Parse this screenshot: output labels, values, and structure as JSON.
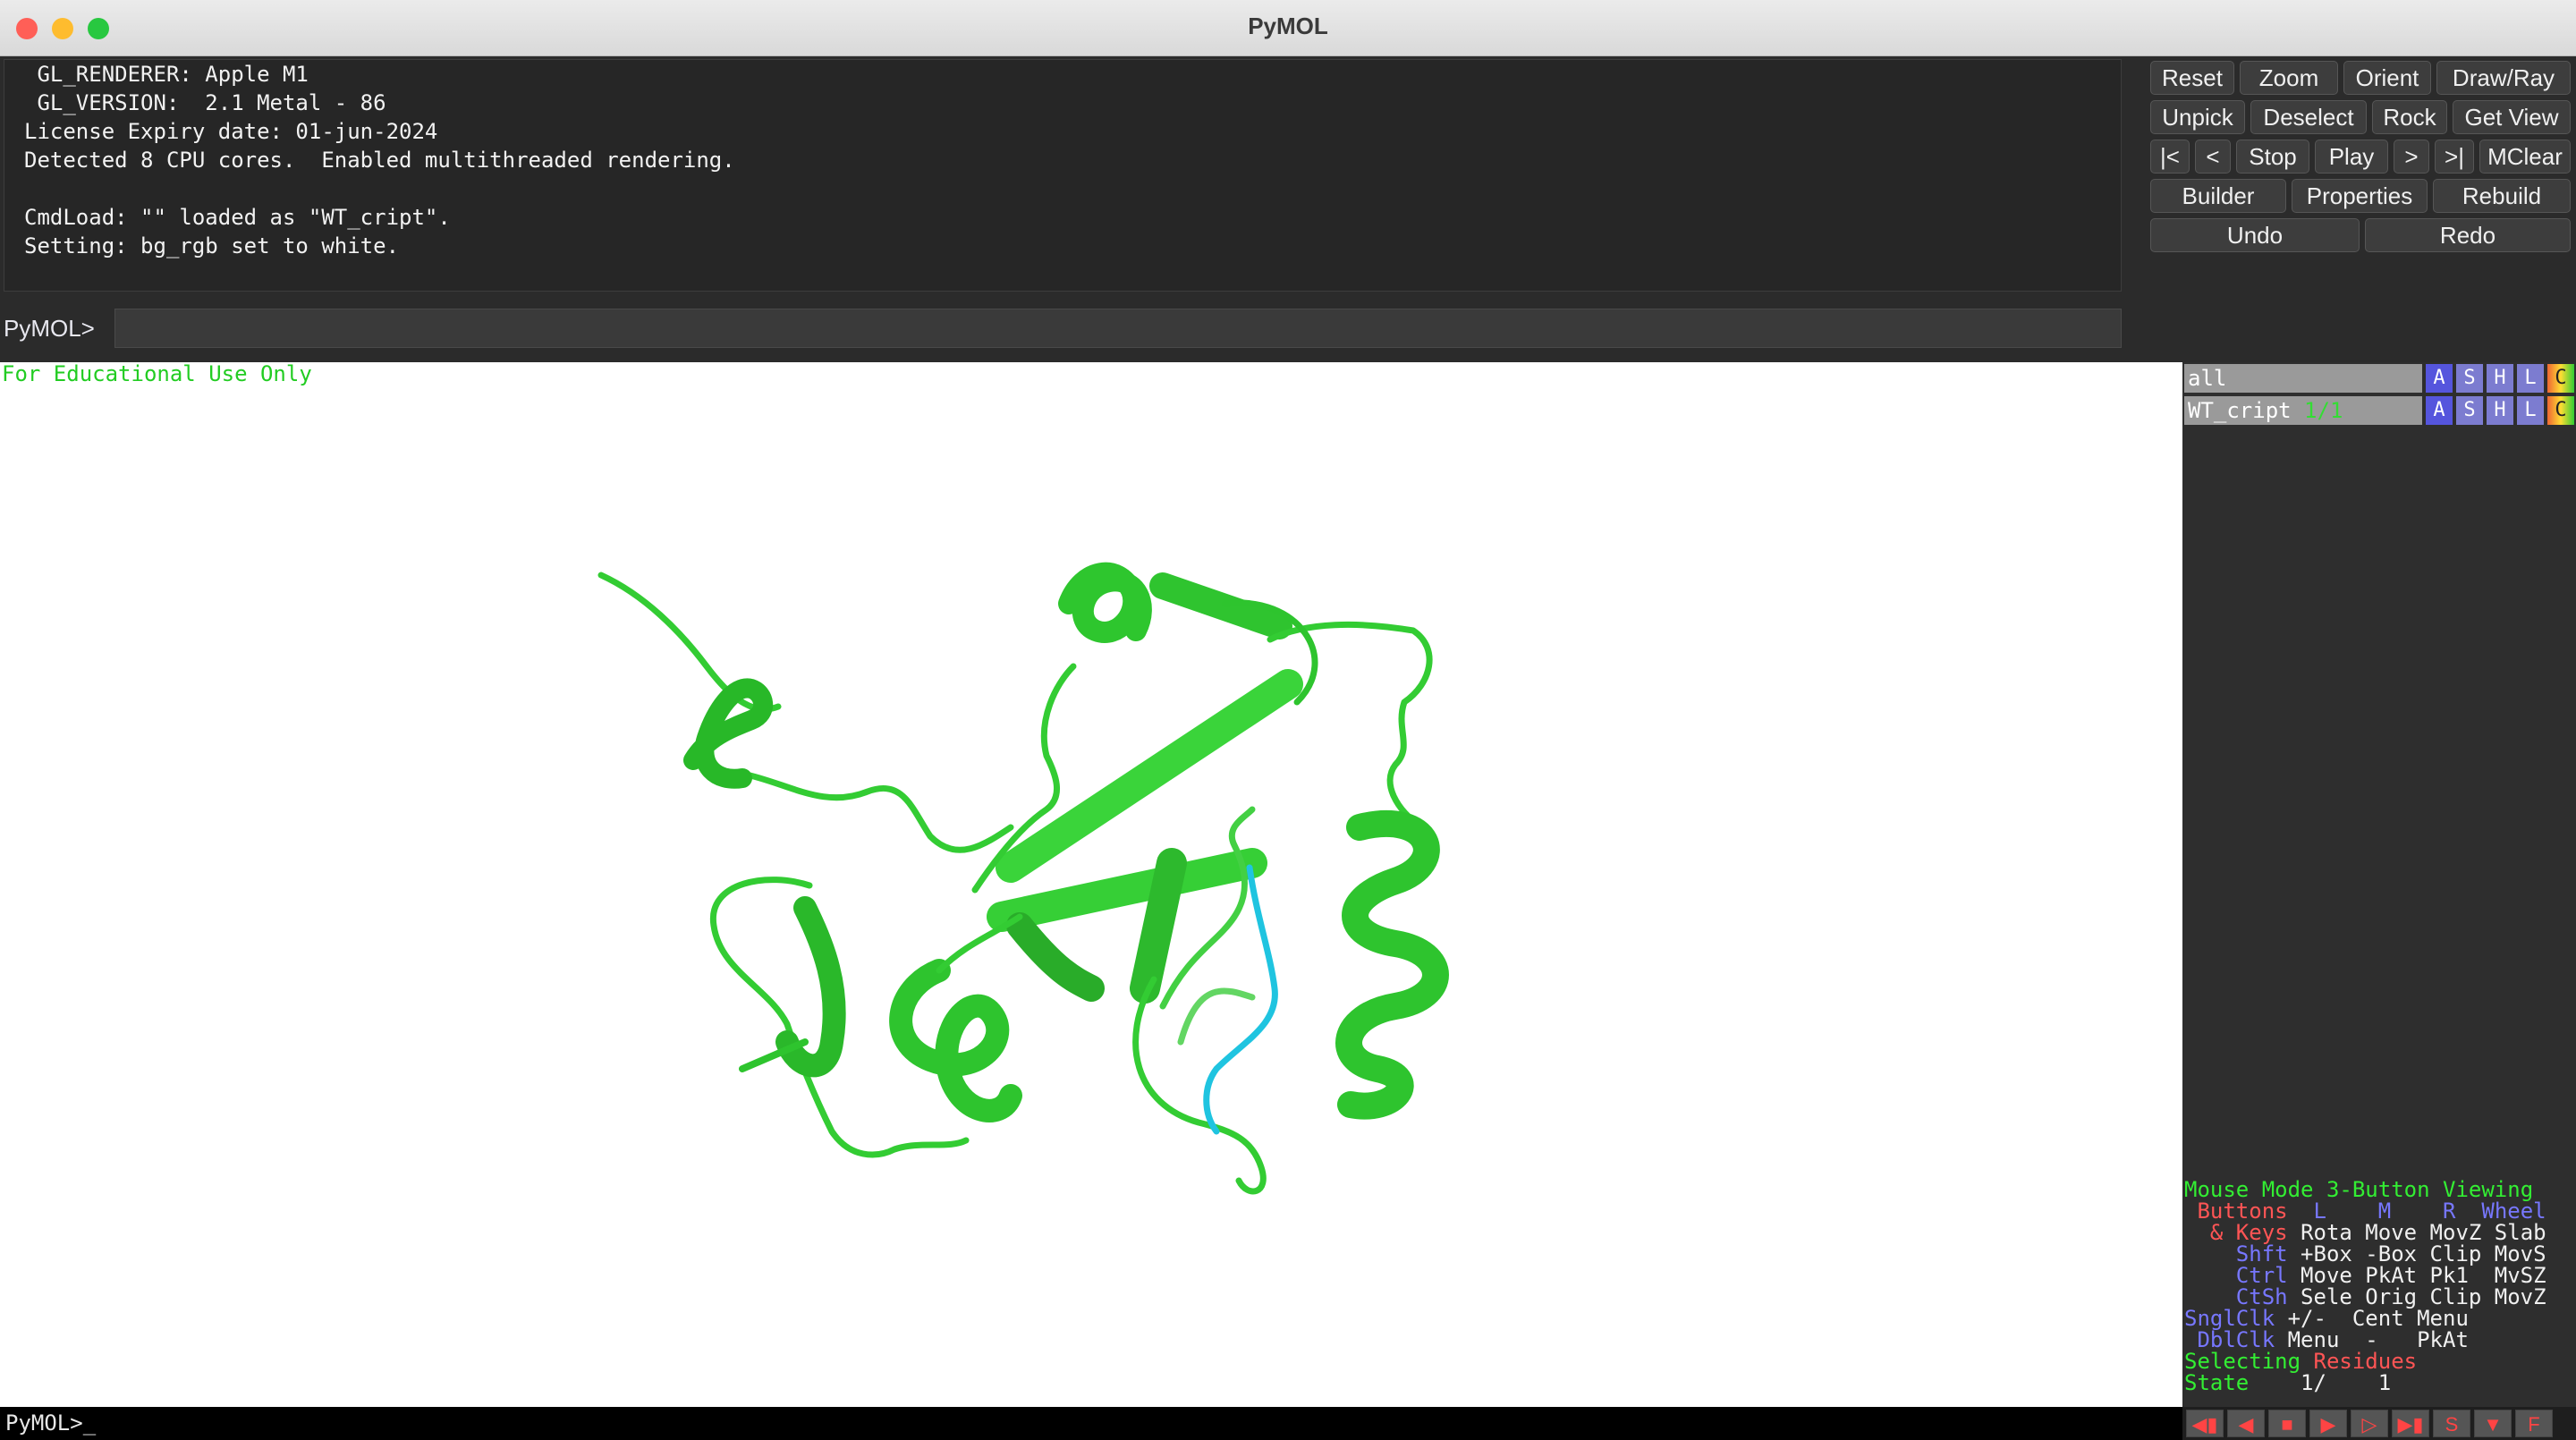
{
  "window": {
    "title": "PyMOL"
  },
  "console": {
    "lines": [
      " GL_RENDERER: Apple M1",
      " GL_VERSION:  2.1 Metal - 86",
      "License Expiry date: 01-jun-2024",
      "Detected 8 CPU cores.  Enabled multithreaded rendering.",
      "",
      "CmdLoad: \"\" loaded as \"WT_cript\".",
      "Setting: bg_rgb set to white."
    ]
  },
  "command": {
    "prompt": "PyMOL>",
    "value": ""
  },
  "buttons": {
    "reset": "Reset",
    "zoom": "Zoom",
    "orient": "Orient",
    "draw_ray": "Draw/Ray",
    "unpick": "Unpick",
    "deselect": "Deselect",
    "rock": "Rock",
    "get_view": "Get View",
    "first": "|<",
    "prev": "<",
    "stop": "Stop",
    "play": "Play",
    "next": ">",
    "last": ">|",
    "mclear": "MClear",
    "builder": "Builder",
    "properties": "Properties",
    "rebuild": "Rebuild",
    "undo": "Undo",
    "redo": "Redo"
  },
  "viewer": {
    "watermark": "For Educational Use Only"
  },
  "objects": [
    {
      "name": "all",
      "state": "",
      "buttons": [
        "A",
        "S",
        "H",
        "L",
        "C"
      ]
    },
    {
      "name": "WT_cript",
      "state": "1/1",
      "buttons": [
        "A",
        "S",
        "H",
        "L",
        "C"
      ]
    }
  ],
  "mouse_panel": {
    "mode_label": "Mouse Mode",
    "mode_value": "3-Button Viewing",
    "buttons_label": "Buttons",
    "col_l": "L",
    "col_m": "M",
    "col_r": "R",
    "col_wheel": "Wheel",
    "keys_label": "& Keys",
    "rows": [
      {
        "key": "",
        "vals": "Rota Move MovZ Slab"
      },
      {
        "key": "Shft",
        "vals": "+Box -Box Clip MovS"
      },
      {
        "key": "Ctrl",
        "vals": "Move PkAt Pk1  MvSZ"
      },
      {
        "key": "CtSh",
        "vals": "Sele Orig Clip MovZ"
      },
      {
        "key": "SnglClk",
        "vals": "+/-  Cent Menu"
      },
      {
        "key": "DblClk",
        "vals": "Menu  -   PkAt"
      }
    ],
    "selecting_label": "Selecting",
    "selecting_value": "Residues",
    "state_label": "State",
    "state_value": "1/    1"
  },
  "bottom_prompt": "PyMOL>_",
  "playback": {
    "s_label": "S",
    "f_label": "F"
  },
  "colors": {
    "protein": "#33cc33",
    "highlight": "#1fc4e0",
    "watermark": "#22cc22",
    "button_a": "#5555dd",
    "button_c": "#ff9900"
  }
}
